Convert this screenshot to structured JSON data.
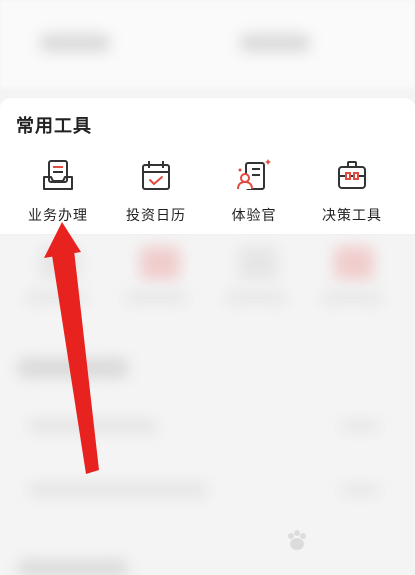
{
  "tools_card": {
    "title": "常用工具",
    "items": [
      {
        "label": "业务办理",
        "icon": "business-handling-icon"
      },
      {
        "label": "投资日历",
        "icon": "investment-calendar-icon"
      },
      {
        "label": "体验官",
        "icon": "experience-officer-icon"
      },
      {
        "label": "决策工具",
        "icon": "decision-tools-icon"
      }
    ]
  },
  "colors": {
    "icon_stroke": "#333333",
    "icon_accent": "#e14b3f",
    "arrow": "#e8231f"
  }
}
